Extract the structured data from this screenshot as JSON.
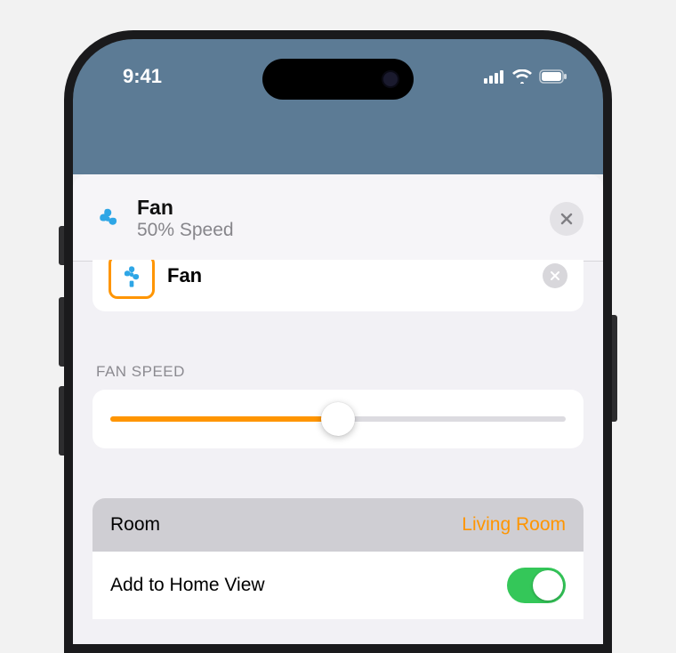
{
  "status": {
    "time": "9:41"
  },
  "sheet": {
    "title": "Fan",
    "subtitle": "50% Speed",
    "icon": "fan-icon"
  },
  "card": {
    "title": "Fan",
    "icon": "fan-icon"
  },
  "section": {
    "speed_label": "FAN SPEED",
    "speed_value_percent": 50
  },
  "rows": {
    "room": {
      "label": "Room",
      "value": "Living Room"
    },
    "home_view": {
      "label": "Add to Home View",
      "toggle_on": true
    }
  },
  "colors": {
    "accent": "#ff9500",
    "toggle_on": "#34c759",
    "header_bg": "#5c7b95"
  }
}
